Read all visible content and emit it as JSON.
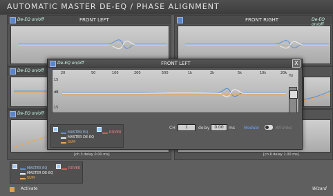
{
  "app": {
    "title": "AUTOMATIC MASTER DE-EQ / PHASE ALIGNMENT"
  },
  "colors": {
    "blue": "#5a8fd8",
    "white": "#f0f0f0",
    "orange": "#e8a65a",
    "red": "#e25555"
  },
  "panels": {
    "front_left": {
      "title": "FRONT LEFT",
      "onoff": "De-EQ on/off"
    },
    "front_right": {
      "title": "FRONT RIGHT",
      "onoff": "De-EQ on/off"
    },
    "mid_left": {
      "onoff": "De-EQ on/off"
    },
    "low_left": {
      "onoff": "De-EQ on/off",
      "delay_text": "[ch 3 delay 0.00 ms]"
    },
    "low_right": {
      "delay_text": "[ch 6 delay 1.00 ms]"
    }
  },
  "ticks": [
    "20",
    "50",
    "100",
    "200",
    "500",
    "1k",
    "2k",
    "5k",
    "10k",
    "20k"
  ],
  "hz_label": "Hz",
  "y_labels": [
    "15",
    "dB",
    "15"
  ],
  "popup": {
    "title": "FRONT LEFT",
    "onoff": "De-EQ on/off",
    "ch_label": "CH",
    "ch_value": "1",
    "delay_label": "delay",
    "delay_value": "0.00",
    "ms_label": "ms",
    "module_label": "Module",
    "alllinks_label": "All links",
    "close": "X"
  },
  "legend": {
    "master_eq": "MASTER EQ",
    "master_de_eq": "MASTER DE-EQ",
    "sum": "SUM",
    "rover": "ROVER"
  },
  "bottom": {
    "activate": "Activate",
    "wizard": "Wizard"
  }
}
